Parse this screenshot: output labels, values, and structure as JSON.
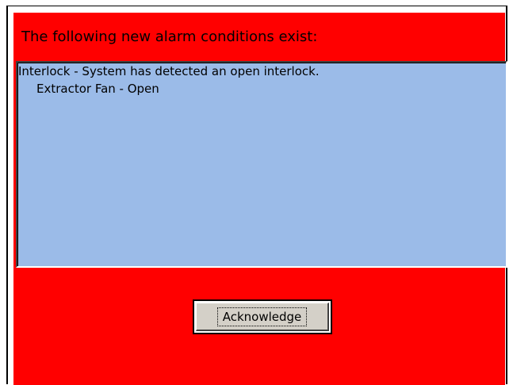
{
  "dialog": {
    "heading": "The following new alarm conditions exist:",
    "alarms": [
      {
        "text": "Interlock - System has detected an open interlock."
      },
      {
        "text": "Extractor Fan - Open"
      }
    ],
    "acknowledge_label": "Acknowledge"
  },
  "colors": {
    "panel_background": "#ff0000",
    "list_background": "#9bbbe8",
    "button_face": "#d4d0c8"
  }
}
